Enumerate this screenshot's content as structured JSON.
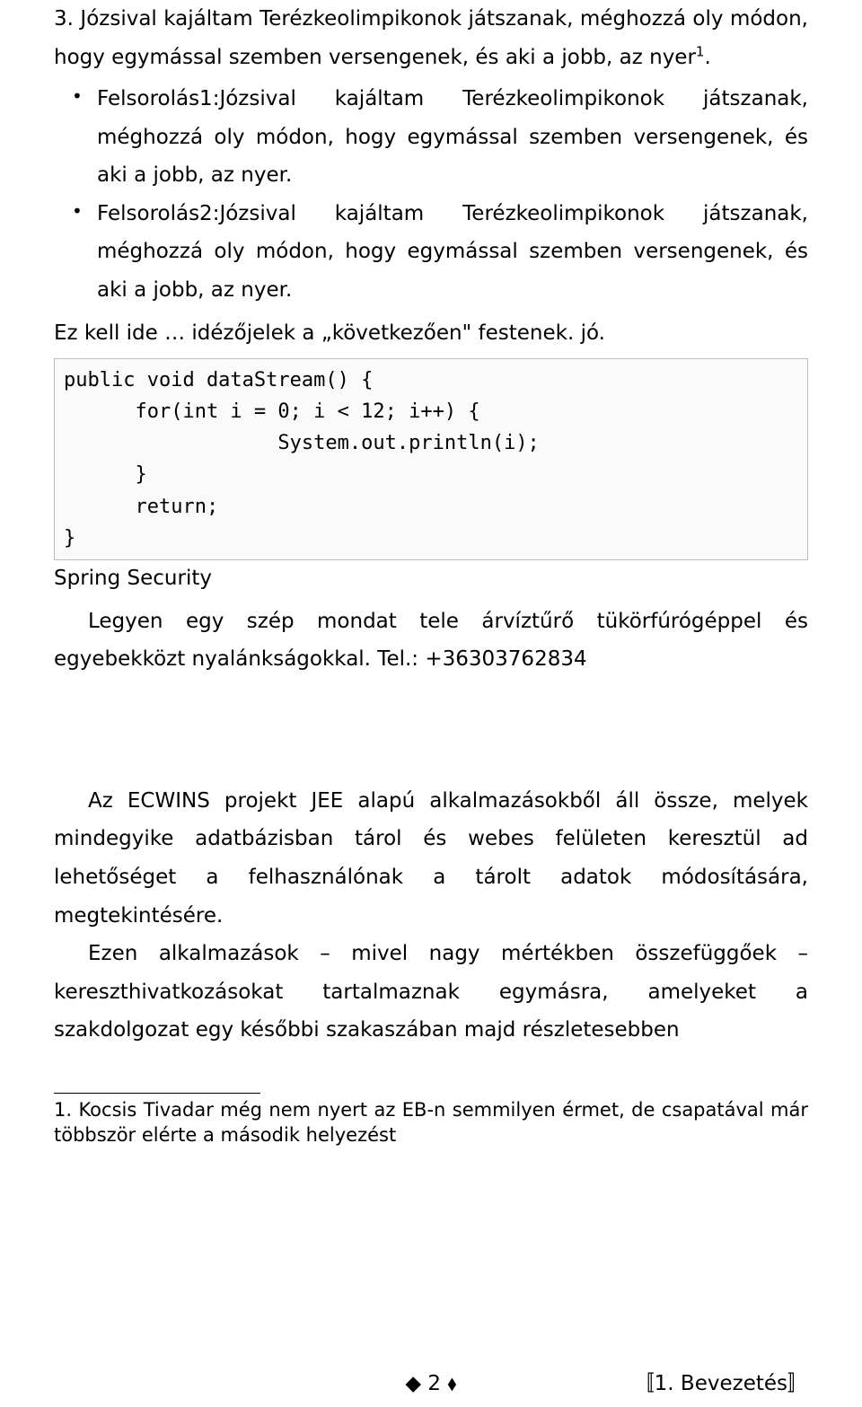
{
  "numbered_item": {
    "text_before_sup": "3. Józsival kajáltam Terézkeolimpikonok játszanak, méghozzá oly módon, hogy egymással szemben versengenek, és aki a jobb, az nyer",
    "sup": "1",
    "text_after_sup": "."
  },
  "bullets": [
    "Felsorolás1:Józsival kajáltam Terézkeolimpikonok játszanak, méghozzá oly módon, hogy egymással szemben versengenek, és aki a jobb, az nyer.",
    "Felsorolás2:Józsival kajáltam Terézkeolimpikonok játszanak, méghozzá oly módon, hogy egymással szemben versengenek, és aki a jobb, az nyer."
  ],
  "line_after_bullets": "Ez kell ide … idézőjelek a „következően\" festenek. jó.",
  "code": "public void dataStream() {\n      for(int i = 0; i < 12; i++) {\n                  System.out.println(i);\n      }\n      return;\n}",
  "spring_line": "Spring Security",
  "para_arviz": "Legyen egy szép mondat tele árvíztűrő tükörfúrógéppel és egyebekközt nyalánkságokkal. Tel.: +36303762834",
  "para_ecwins": "Az ECWINS projekt JEE alapú alkalmazásokből áll össze, melyek mindegyike adatbázisban tárol és webes felületen keresztül ad lehetőséget a felhasználónak a tárolt adatok módosítására, megtekintésére.",
  "para_ezen": "Ezen alkalmazások – mivel nagy mértékben összefüggőek – kereszthivatkozásokat tartalmaznak egymásra, amelyeket a szakdolgozat egy későbbi szakaszában majd részletesebben",
  "footnote": "1. Kocsis Tivadar még nem nyert az EB-n semmilyen érmet, de csapatával már többször elérte a második helyezést",
  "footer": {
    "center_prefix": "◆ ",
    "page_number": "2",
    "center_suffix": " ⬧",
    "right_prefix": "〚",
    "right_text": "1. Bevezetés",
    "right_suffix": "〛"
  }
}
